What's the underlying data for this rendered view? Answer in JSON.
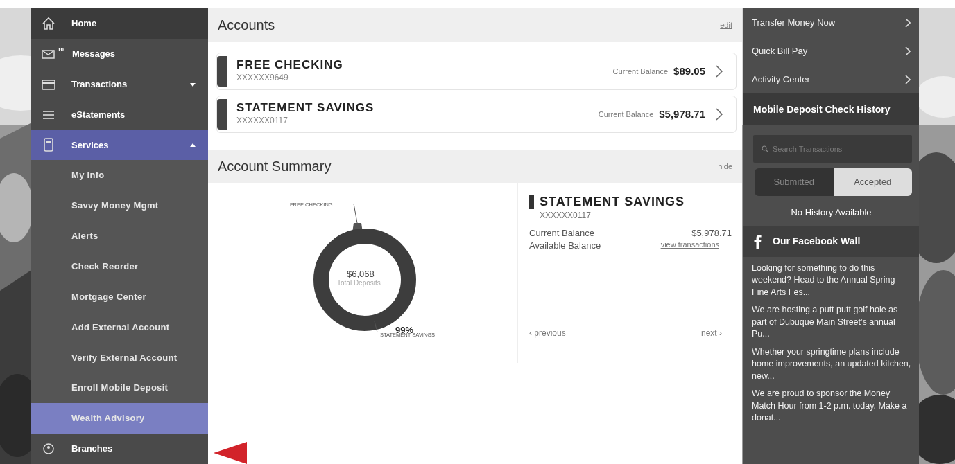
{
  "sidebar": {
    "items": [
      {
        "label": "Home",
        "selected": false
      },
      {
        "label": "Messages",
        "badge": "10",
        "selected": false
      },
      {
        "label": "Transactions",
        "selected": false,
        "expanded": false
      },
      {
        "label": "eStatements",
        "selected": false
      },
      {
        "label": "Services",
        "selected": true,
        "expanded": true,
        "children": [
          {
            "label": "My Info",
            "selected": false
          },
          {
            "label": "Savvy Money Mgmt",
            "selected": false
          },
          {
            "label": "Alerts",
            "selected": false
          },
          {
            "label": "Check Reorder",
            "selected": false
          },
          {
            "label": "Mortgage Center",
            "selected": false
          },
          {
            "label": "Add External Account",
            "selected": false
          },
          {
            "label": "Verify External Account",
            "selected": false
          },
          {
            "label": "Enroll Mobile Deposit",
            "selected": false
          },
          {
            "label": "Wealth Advisory",
            "selected": true
          }
        ]
      },
      {
        "label": "Branches",
        "selected": false
      }
    ]
  },
  "accounts": {
    "title": "Accounts",
    "action": "edit",
    "items": [
      {
        "name": "FREE CHECKING",
        "number": "XXXXXX9649",
        "balance_label": "Current Balance",
        "balance": "$89.05"
      },
      {
        "name": "STATEMENT SAVINGS",
        "number": "XXXXXX0117",
        "balance_label": "Current Balance",
        "balance": "$5,978.71"
      }
    ]
  },
  "summary": {
    "title": "Account Summary",
    "action": "hide",
    "donut": {
      "total": "$6,068",
      "total_label": "Total Deposits",
      "top_label": "FREE CHECKING",
      "bottom_percent": "99%",
      "bottom_label": "STATEMENT SAVINGS"
    },
    "detail": {
      "name": "STATEMENT SAVINGS",
      "number": "XXXXXX0117",
      "rows": [
        {
          "label": "Current Balance",
          "value": "$5,978.71",
          "kind": "text"
        },
        {
          "label": "Available Balance",
          "value": "view transactions",
          "kind": "link"
        }
      ],
      "previous": "‹ previous",
      "next": "next ›"
    }
  },
  "quick_links": [
    {
      "label": "Transfer Money Now"
    },
    {
      "label": "Quick Bill Pay"
    },
    {
      "label": "Activity Center"
    }
  ],
  "deposit_history": {
    "title": "Mobile Deposit Check History",
    "search": {
      "placeholder": "Search Transactions"
    },
    "toggle": [
      {
        "label": "Submitted",
        "selected": false
      },
      {
        "label": "Accepted",
        "selected": true
      }
    ],
    "empty": "No History Available"
  },
  "facebook": {
    "title": "Our Facebook Wall",
    "posts": [
      "Looking for something to do this weekend? Head to the Annual Spring Fine Arts Fes...",
      "We are  hosting a putt putt golf hole as part of Dubuque Main Street's annual Pu...",
      "Whether your springtime plans include home improvements, an updated kitchen, new...",
      "We are proud to sponsor the Money Match Hour from 1-2 p.m. today. Make a donat..."
    ]
  }
}
